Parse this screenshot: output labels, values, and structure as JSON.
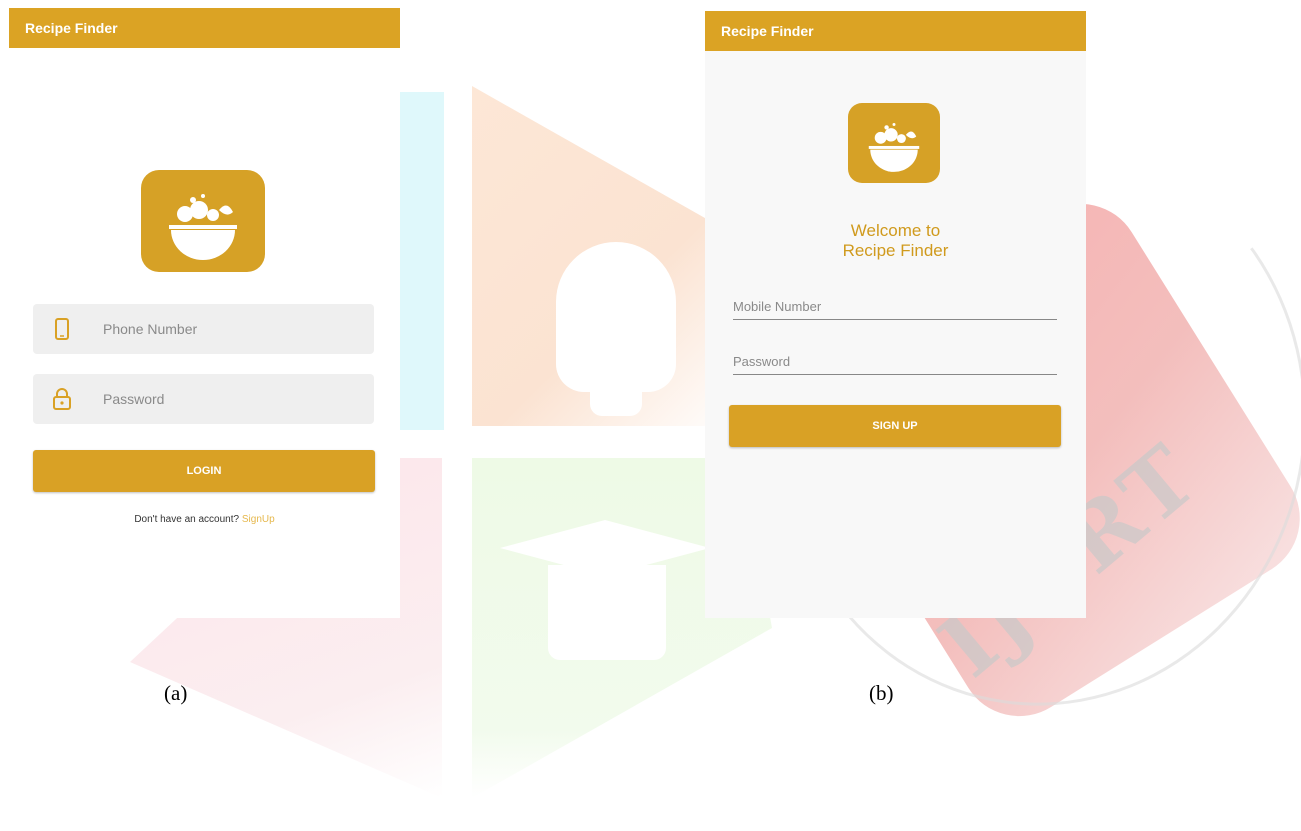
{
  "screen_a": {
    "app_title": "Recipe Finder",
    "phone_placeholder": "Phone Number",
    "password_placeholder": "Password",
    "login_label": "LOGIN",
    "no_account_text": "Don't have an account?",
    "signup_link": "SignUp",
    "icons": [
      "phone-icon",
      "lock-icon",
      "salad-bowl-icon"
    ]
  },
  "screen_b": {
    "app_title": "Recipe Finder",
    "welcome_line1": "Welcome to",
    "welcome_line2": "Recipe Finder",
    "mobile_placeholder": "Mobile Number",
    "password_placeholder": "Password",
    "signup_label": "SIGN UP",
    "icons": [
      "salad-bowl-icon"
    ]
  },
  "captions": {
    "a": "(a)",
    "b": "(b)"
  },
  "watermark": {
    "text": "IJCRT"
  },
  "colors": {
    "accent": "#dba324",
    "link": "#e6b84d",
    "field_bg": "#efefef"
  }
}
